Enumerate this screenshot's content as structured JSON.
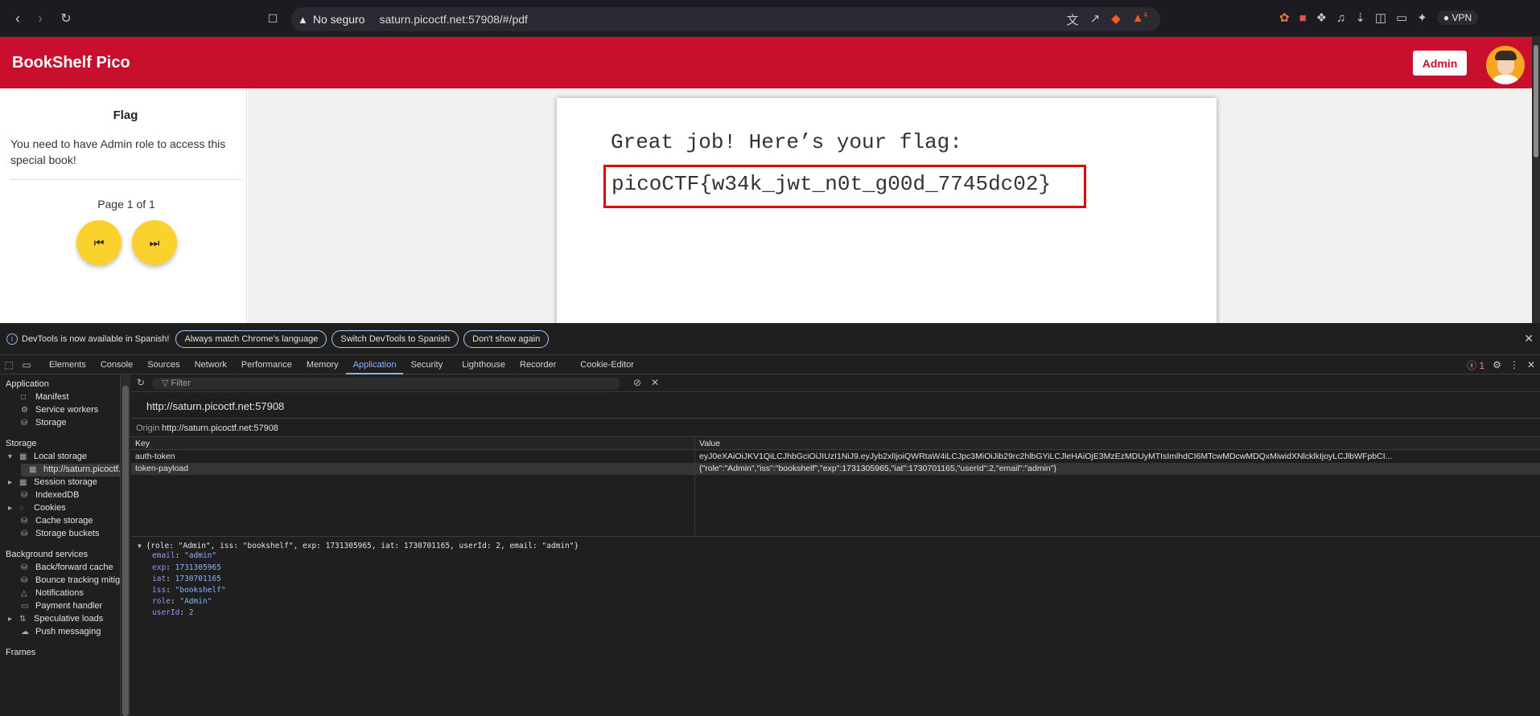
{
  "browser": {
    "security": "No seguro",
    "url": "saturn.picoctf.net:57908/#/pdf",
    "vpn_label": "VPN",
    "brave_count": "4"
  },
  "app": {
    "brand": "BookShelf Pico",
    "admin_button": "Admin"
  },
  "sidebar": {
    "title": "Flag",
    "message": "You need to have Admin role to access this special book!",
    "page_info": "Page 1 of 1"
  },
  "pdf": {
    "line1": "Great job! Here’s your flag:",
    "flag": "picoCTF{w34k_jwt_n0t_g00d_7745dc02}"
  },
  "devtools": {
    "infobar": {
      "text": "DevTools is now available in Spanish!",
      "btn1": "Always match Chrome's language",
      "btn2": "Switch DevTools to Spanish",
      "btn3": "Don't show again"
    },
    "tabs": [
      "Elements",
      "Console",
      "Sources",
      "Network",
      "Performance",
      "Memory",
      "Application",
      "Security",
      "Lighthouse",
      "Recorder",
      "Cookie-Editor"
    ],
    "error_count": "1",
    "filter_placeholder": "Filter",
    "sidebar": {
      "application": "Application",
      "manifest": "Manifest",
      "service_workers": "Service workers",
      "storage_item": "Storage",
      "storage": "Storage",
      "local_storage": "Local storage",
      "local_origin": "http://saturn.picoctf.ne...",
      "session_storage": "Session storage",
      "indexeddb": "IndexedDB",
      "cookies": "Cookies",
      "cache_storage": "Cache storage",
      "storage_buckets": "Storage buckets",
      "background_services": "Background services",
      "bfcache": "Back/forward cache",
      "bounce": "Bounce tracking mitigati...",
      "notifications": "Notifications",
      "payment": "Payment handler",
      "speculative": "Speculative loads",
      "push": "Push messaging",
      "frames": "Frames"
    },
    "origin_heading": "http://saturn.picoctf.net:57908",
    "origin_label": "Origin",
    "origin_value": "http://saturn.picoctf.net:57908",
    "table": {
      "key_header": "Key",
      "value_header": "Value",
      "rows": [
        {
          "key": "auth-token",
          "value": "eyJ0eXAiOiJKV1QiLCJhbGciOiJIUzI1NiJ9.eyJyb2xlIjoiQWRtaW4iLCJpc3MiOiJib29rc2hlbGYiLCJleHAiOjE3MzEzMDUyMTIsImlhdCI6MTcwMDcwMDQxMiwidXNlcklkIjoyLCJlbWFpbCI..."
        },
        {
          "key": "token-payload",
          "value": "{\"role\":\"Admin\",\"iss\":\"bookshelf\",\"exp\":1731305965,\"iat\":1730701165,\"userId\":2,\"email\":\"admin\"}"
        }
      ]
    },
    "preview": {
      "summary": "{role: \"Admin\", iss: \"bookshelf\", exp: 1731305965, iat: 1730701165, userId: 2, email: \"admin\"}",
      "fields": [
        {
          "k": "email",
          "v": "\"admin\""
        },
        {
          "k": "exp",
          "v": "1731305965"
        },
        {
          "k": "iat",
          "v": "1730701165"
        },
        {
          "k": "iss",
          "v": "\"bookshelf\""
        },
        {
          "k": "role",
          "v": "\"Admin\""
        },
        {
          "k": "userId",
          "v": "2"
        }
      ]
    }
  }
}
